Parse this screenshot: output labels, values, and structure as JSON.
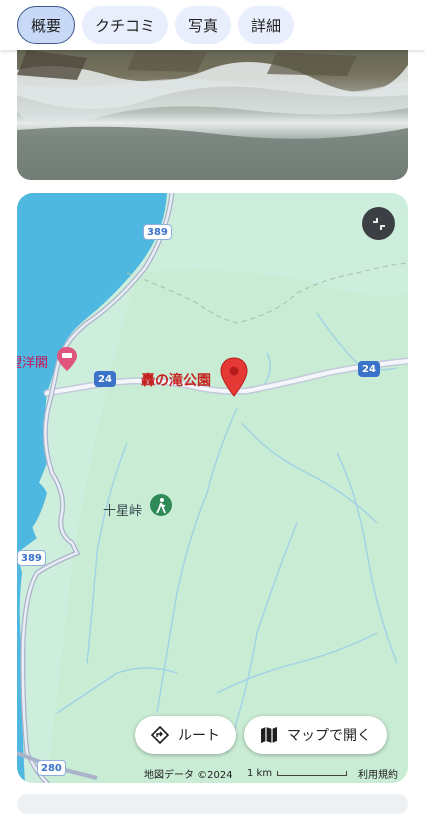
{
  "tabs": [
    {
      "label": "概要",
      "active": true
    },
    {
      "label": "クチコミ",
      "active": false
    },
    {
      "label": "写真",
      "active": false
    },
    {
      "label": "詳細",
      "active": false
    }
  ],
  "map": {
    "pin_label": "轟の滝公園",
    "hotel_label": "望洋閣",
    "hiking_label": "十星峠",
    "route_shields": [
      "389",
      "24",
      "24",
      "389",
      "280"
    ],
    "buttons": {
      "route": "ルート",
      "open_map": "マップで開く"
    },
    "attribution": {
      "data": "地図データ ©2024",
      "scale": "1 km",
      "terms": "利用規約"
    },
    "colors": {
      "land": "#cdeedd",
      "water": "#4fb8e0",
      "road": "#cfd6e6",
      "pin": "#e53935",
      "accent": "#3a73c9"
    }
  }
}
